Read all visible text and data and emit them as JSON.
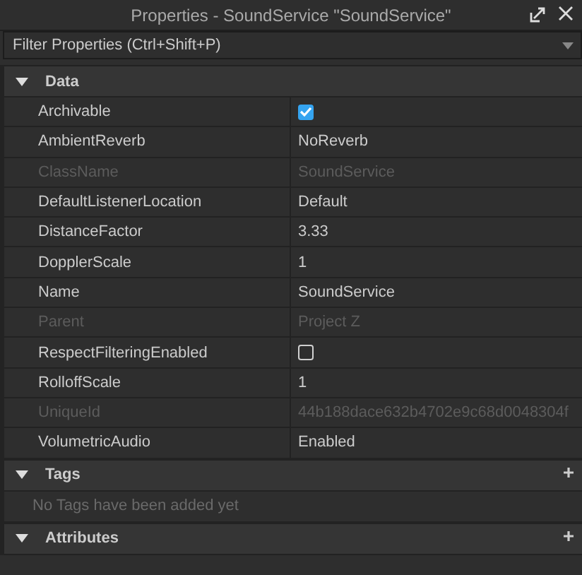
{
  "window": {
    "title": "Properties - SoundService \"SoundService\""
  },
  "filter": {
    "placeholder": "Filter Properties (Ctrl+Shift+P)"
  },
  "sections": [
    {
      "title": "Data",
      "expanded": true,
      "properties": [
        {
          "name": "Archivable",
          "kind": "checkbox",
          "checked": true,
          "disabled": false
        },
        {
          "name": "AmbientReverb",
          "kind": "text",
          "value": "NoReverb",
          "disabled": false
        },
        {
          "name": "ClassName",
          "kind": "text",
          "value": "SoundService",
          "disabled": true
        },
        {
          "name": "DefaultListenerLocation",
          "kind": "text",
          "value": "Default",
          "disabled": false
        },
        {
          "name": "DistanceFactor",
          "kind": "text",
          "value": "3.33",
          "disabled": false
        },
        {
          "name": "DopplerScale",
          "kind": "text",
          "value": "1",
          "disabled": false
        },
        {
          "name": "Name",
          "kind": "text",
          "value": "SoundService",
          "disabled": false
        },
        {
          "name": "Parent",
          "kind": "text",
          "value": "Project Z",
          "disabled": true
        },
        {
          "name": "RespectFilteringEnabled",
          "kind": "checkbox",
          "checked": false,
          "disabled": false
        },
        {
          "name": "RolloffScale",
          "kind": "text",
          "value": "1",
          "disabled": false
        },
        {
          "name": "UniqueId",
          "kind": "text",
          "value": "44b188dace632b4702e9c68d0048304f",
          "disabled": true
        },
        {
          "name": "VolumetricAudio",
          "kind": "text",
          "value": "Enabled",
          "disabled": false
        }
      ]
    },
    {
      "title": "Tags",
      "expanded": true,
      "empty_message": "No Tags have been added yet"
    },
    {
      "title": "Attributes",
      "expanded": true
    }
  ]
}
